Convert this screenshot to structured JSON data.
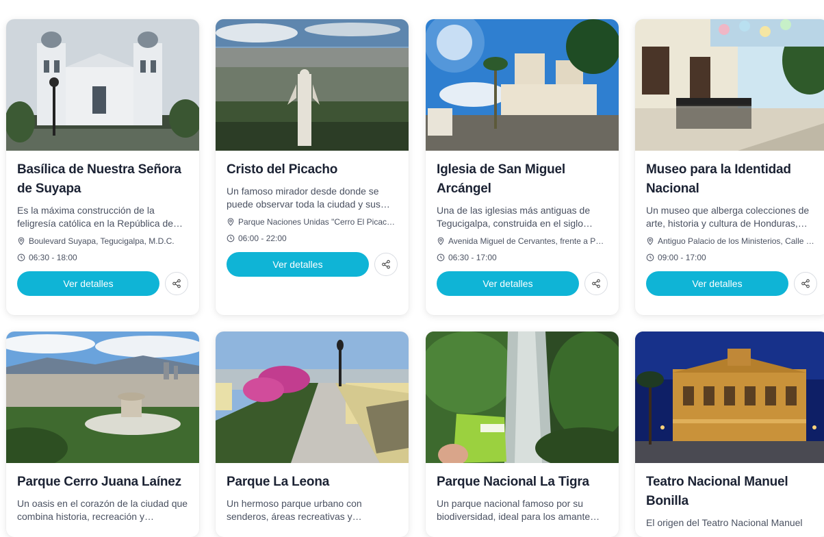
{
  "cards": [
    {
      "title": "Basílica de Nuestra Señora de Suyapa",
      "description": "Es la máxima construcción de la feligresía católica en la República de…",
      "address": "Boulevard Suyapa, Tegucigalpa, M.D.C.",
      "hours": "06:30 - 18:00",
      "button": "Ver detalles",
      "image": "basilica-photo"
    },
    {
      "title": "Cristo del Picacho",
      "description": "Un famoso mirador desde donde se puede observar toda la ciudad y sus…",
      "address": "Parque Naciones Unidas \"Cerro El Picach…",
      "hours": "06:00 - 22:00",
      "button": "Ver detalles",
      "image": "cristo-picacho-photo"
    },
    {
      "title": "Iglesia de San Miguel Arcángel",
      "description": "Una de las iglesias más antiguas de Tegucigalpa, construida en el siglo…",
      "address": "Avenida Miguel de Cervantes, frente a P…",
      "hours": "06:30 - 17:00",
      "button": "Ver detalles",
      "image": "iglesia-photo"
    },
    {
      "title": "Museo para la Identidad Nacional",
      "description": "Un museo que alberga colecciones de arte, historia y cultura de Honduras,…",
      "address": "Antiguo Palacio de los Ministerios, Calle …",
      "hours": "09:00 - 17:00",
      "button": "Ver detalles",
      "image": "museo-photo"
    },
    {
      "title": "Parque Cerro Juana Laínez",
      "description": "Un oasis en el corazón de la ciudad que combina historia, recreación y…",
      "image": "juana-lainez-photo"
    },
    {
      "title": "Parque La Leona",
      "description": "Un hermoso parque urbano con senderos, áreas recreativas y…",
      "image": "la-leona-photo"
    },
    {
      "title": "Parque Nacional La Tigra",
      "description": "Un parque nacional famoso por su biodiversidad, ideal para los amante…",
      "image": "la-tigra-photo"
    },
    {
      "title": "Teatro Nacional Manuel Bonilla",
      "description": "El origen del Teatro Nacional Manuel",
      "image": "teatro-photo"
    }
  ],
  "icons": {
    "location": "map-pin-icon",
    "hours": "clock-icon",
    "share": "share-icon"
  },
  "colors": {
    "accent": "#0fb4d6",
    "title": "#1b2233",
    "text": "#4a5161"
  }
}
